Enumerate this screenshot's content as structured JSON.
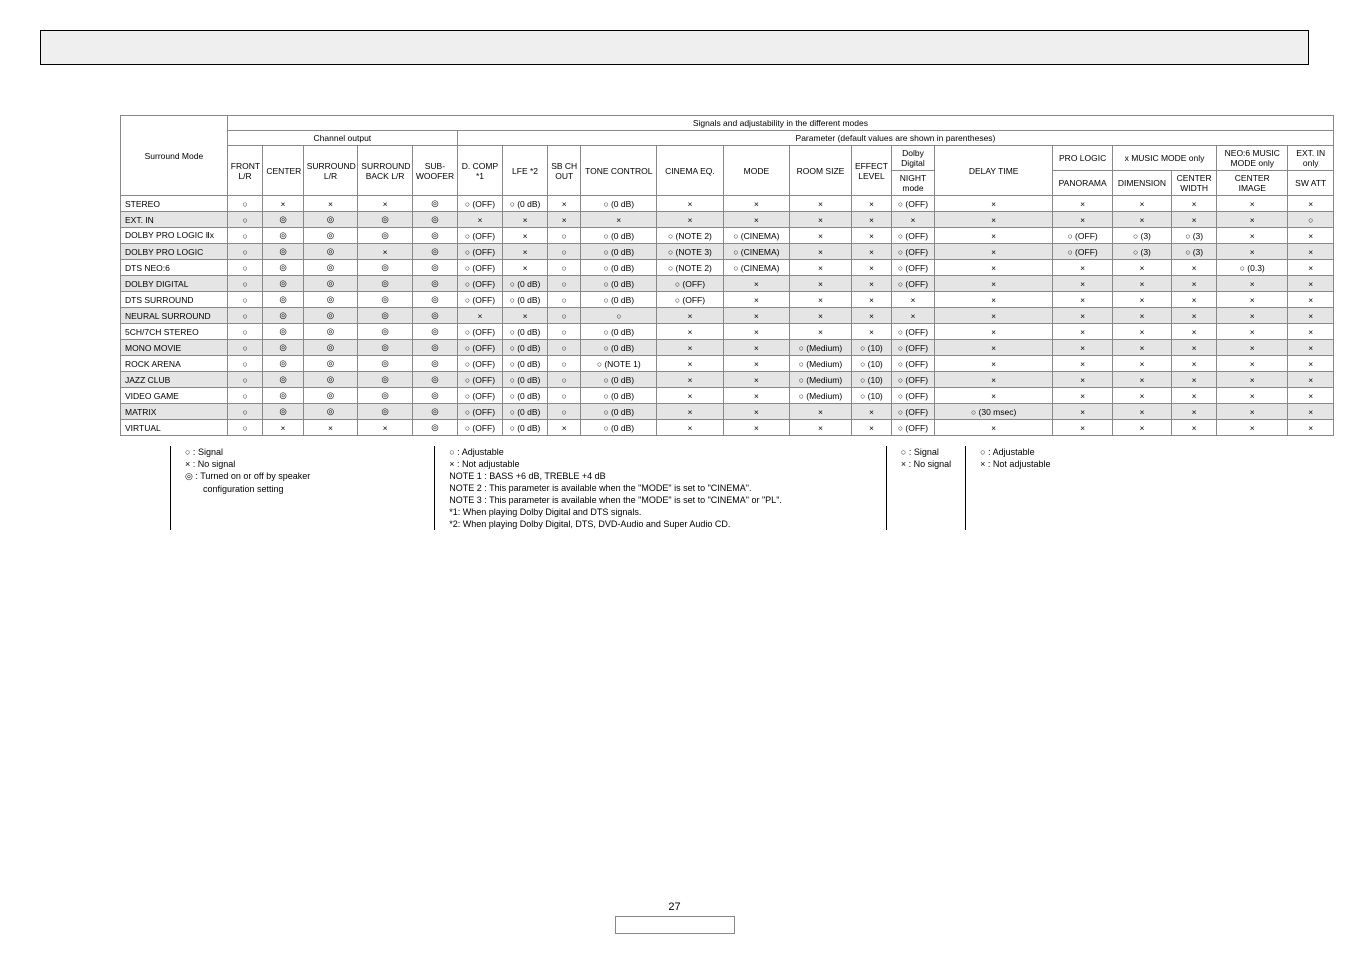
{
  "title_row": {
    "signals": "Signals and adjustability in the different modes"
  },
  "hdr": {
    "sm": "Surround Mode",
    "co": "Channel output",
    "param": "Parameter (default values are shown in parentheses)",
    "front": "FRONT L/R",
    "center": "CENTER",
    "surr": "SURROUND L/R",
    "sback": "SURROUND BACK L/R",
    "sub": "SUB-WOOFER",
    "dcomp": "D. COMP *1",
    "lfe": "LFE *2",
    "sbch": "SB CH OUT",
    "tone": "TONE CONTROL",
    "ceq": "CINEMA EQ.",
    "mode": "MODE",
    "room": "ROOM SIZE",
    "eff": "EFFECT LEVEL",
    "dolby": "Dolby Digital",
    "night": "NIGHT mode",
    "delay": "DELAY TIME",
    "pro": "PRO LOGIC",
    "music": "x MUSIC MODE only",
    "pano": "PANORAMA",
    "dim": "DIMENSION",
    "cw": "CENTER WIDTH",
    "neo": "NEO:6 MUSIC MODE only",
    "ci": "CENTER IMAGE",
    "ext": "EXT. IN only",
    "sw": "SW ATT"
  },
  "rows": [
    {
      "n": "STEREO",
      "c": [
        "○",
        "×",
        "×",
        "×",
        "◎",
        "○ (OFF)",
        "○ (0 dB)",
        "×",
        "○ (0 dB)",
        "×",
        "×",
        "×",
        "×",
        "○ (OFF)",
        "×",
        "×",
        "×",
        "×",
        "×",
        "×"
      ]
    },
    {
      "n": "EXT. IN",
      "c": [
        "○",
        "◎",
        "◎",
        "◎",
        "◎",
        "×",
        "×",
        "×",
        "×",
        "×",
        "×",
        "×",
        "×",
        "×",
        "×",
        "×",
        "×",
        "×",
        "×",
        "○"
      ],
      "a": 1
    },
    {
      "n": "DOLBY PRO LOGIC Ⅱx",
      "c": [
        "○",
        "◎",
        "◎",
        "◎",
        "◎",
        "○ (OFF)",
        "×",
        "○",
        "○ (0 dB)",
        "○ (NOTE 2)",
        "○ (CINEMA)",
        "×",
        "×",
        "○ (OFF)",
        "×",
        "○ (OFF)",
        "○ (3)",
        "○ (3)",
        "×",
        "×"
      ]
    },
    {
      "n": "DOLBY PRO LOGIC",
      "c": [
        "○",
        "◎",
        "◎",
        "×",
        "◎",
        "○ (OFF)",
        "×",
        "○",
        "○ (0 dB)",
        "○ (NOTE 3)",
        "○ (CINEMA)",
        "×",
        "×",
        "○ (OFF)",
        "×",
        "○ (OFF)",
        "○ (3)",
        "○ (3)",
        "×",
        "×"
      ],
      "a": 1
    },
    {
      "n": "DTS NEO:6",
      "c": [
        "○",
        "◎",
        "◎",
        "◎",
        "◎",
        "○ (OFF)",
        "×",
        "○",
        "○ (0 dB)",
        "○ (NOTE 2)",
        "○ (CINEMA)",
        "×",
        "×",
        "○ (OFF)",
        "×",
        "×",
        "×",
        "×",
        "○ (0.3)",
        "×"
      ]
    },
    {
      "n": "DOLBY DIGITAL",
      "c": [
        "○",
        "◎",
        "◎",
        "◎",
        "◎",
        "○ (OFF)",
        "○ (0 dB)",
        "○",
        "○ (0 dB)",
        "○ (OFF)",
        "×",
        "×",
        "×",
        "○ (OFF)",
        "×",
        "×",
        "×",
        "×",
        "×",
        "×"
      ],
      "a": 1
    },
    {
      "n": "DTS SURROUND",
      "c": [
        "○",
        "◎",
        "◎",
        "◎",
        "◎",
        "○ (OFF)",
        "○ (0 dB)",
        "○",
        "○ (0 dB)",
        "○ (OFF)",
        "×",
        "×",
        "×",
        "×",
        "×",
        "×",
        "×",
        "×",
        "×",
        "×"
      ]
    },
    {
      "n": "NEURAL SURROUND",
      "c": [
        "○",
        "◎",
        "◎",
        "◎",
        "◎",
        "×",
        "×",
        "○",
        "○",
        "×",
        "×",
        "×",
        "×",
        "×",
        "×",
        "×",
        "×",
        "×",
        "×",
        "×"
      ],
      "a": 1
    },
    {
      "n": "5CH/7CH STEREO",
      "c": [
        "○",
        "◎",
        "◎",
        "◎",
        "◎",
        "○ (OFF)",
        "○ (0 dB)",
        "○",
        "○ (0 dB)",
        "×",
        "×",
        "×",
        "×",
        "○ (OFF)",
        "×",
        "×",
        "×",
        "×",
        "×",
        "×"
      ]
    },
    {
      "n": "MONO MOVIE",
      "c": [
        "○",
        "◎",
        "◎",
        "◎",
        "◎",
        "○ (OFF)",
        "○ (0 dB)",
        "○",
        "○ (0 dB)",
        "×",
        "×",
        "○ (Medium)",
        "○ (10)",
        "○ (OFF)",
        "×",
        "×",
        "×",
        "×",
        "×",
        "×"
      ],
      "a": 1
    },
    {
      "n": "ROCK ARENA",
      "c": [
        "○",
        "◎",
        "◎",
        "◎",
        "◎",
        "○ (OFF)",
        "○ (0 dB)",
        "○",
        "○ (NOTE 1)",
        "×",
        "×",
        "○ (Medium)",
        "○ (10)",
        "○ (OFF)",
        "×",
        "×",
        "×",
        "×",
        "×",
        "×"
      ]
    },
    {
      "n": "JAZZ CLUB",
      "c": [
        "○",
        "◎",
        "◎",
        "◎",
        "◎",
        "○ (OFF)",
        "○ (0 dB)",
        "○",
        "○ (0 dB)",
        "×",
        "×",
        "○ (Medium)",
        "○ (10)",
        "○ (OFF)",
        "×",
        "×",
        "×",
        "×",
        "×",
        "×"
      ],
      "a": 1
    },
    {
      "n": "VIDEO GAME",
      "c": [
        "○",
        "◎",
        "◎",
        "◎",
        "◎",
        "○ (OFF)",
        "○ (0 dB)",
        "○",
        "○ (0 dB)",
        "×",
        "×",
        "○ (Medium)",
        "○ (10)",
        "○ (OFF)",
        "×",
        "×",
        "×",
        "×",
        "×",
        "×"
      ]
    },
    {
      "n": "MATRIX",
      "c": [
        "○",
        "◎",
        "◎",
        "◎",
        "◎",
        "○ (OFF)",
        "○ (0 dB)",
        "○",
        "○ (0 dB)",
        "×",
        "×",
        "×",
        "×",
        "○ (OFF)",
        "○ (30 msec)",
        "×",
        "×",
        "×",
        "×",
        "×"
      ],
      "a": 1
    },
    {
      "n": "VIRTUAL",
      "c": [
        "○",
        "×",
        "×",
        "×",
        "◎",
        "○ (OFF)",
        "○ (0 dB)",
        "×",
        "○ (0 dB)",
        "×",
        "×",
        "×",
        "×",
        "○ (OFF)",
        "×",
        "×",
        "×",
        "×",
        "×",
        "×"
      ]
    }
  ],
  "notes": {
    "b1": [
      "○ :  Signal",
      "× :  No signal",
      "◎ :  Turned on or off by speaker",
      "      configuration setting"
    ],
    "b2": [
      "○ :  Adjustable",
      "× :  Not adjustable",
      "NOTE 1 : BASS +6 dB, TREBLE +4 dB",
      "NOTE 2 : This parameter is available when the \"MODE\" is set to \"CINEMA\".",
      "NOTE 3 : This parameter is available when the \"MODE\" is set to \"CINEMA\" or \"PL\".",
      "*1:  When playing Dolby Digital and DTS signals.",
      "*2:  When playing Dolby Digital, DTS, DVD-Audio and Super Audio CD."
    ],
    "b3": [
      "○ :  Signal",
      "× :  No signal"
    ],
    "b4": [
      "○ :  Adjustable",
      "× :  Not adjustable"
    ]
  },
  "page": "27"
}
